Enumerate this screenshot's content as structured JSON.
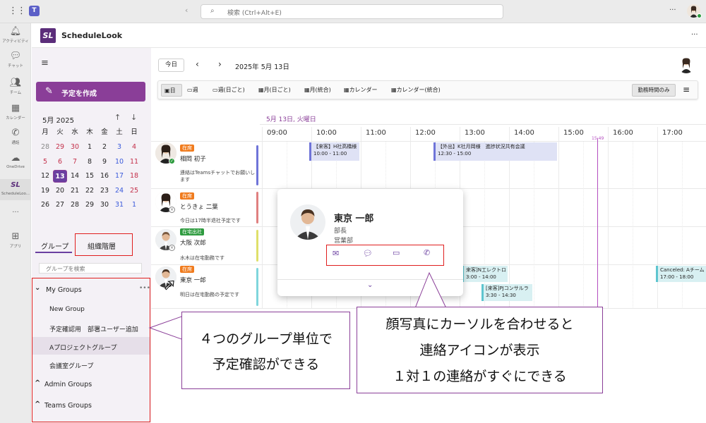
{
  "colors": {
    "brand": "#8a3e98",
    "accent_purple": "#6a3fa0",
    "red_outline": "#e01e1e",
    "event_blue": "#dfe2f5",
    "event_teal": "#d8f0f2",
    "current_time": "#b44ec0"
  },
  "titlebar": {
    "search_placeholder": "検索 (Ctrl+Alt+E)",
    "more": "···"
  },
  "rail": [
    {
      "label": "アクティビティ",
      "icon": "bell-icon"
    },
    {
      "label": "チャット",
      "icon": "chat-icon"
    },
    {
      "label": "チーム",
      "icon": "teams-icon"
    },
    {
      "label": "カレンダー",
      "icon": "calendar-icon"
    },
    {
      "label": "通話",
      "icon": "phone-icon"
    },
    {
      "label": "OneDrive",
      "icon": "cloud-icon"
    },
    {
      "label": "ScheduleLoo...",
      "icon": "schedulelook-icon"
    },
    {
      "label": "···",
      "icon": "more-icon"
    },
    {
      "label": "アプリ",
      "icon": "apps-icon"
    }
  ],
  "app": {
    "name": "ScheduleLook",
    "logo": "SL",
    "more": "···"
  },
  "left": {
    "create_label": "予定を作成",
    "month_label": "5月 2025",
    "weekdays": [
      "月",
      "火",
      "水",
      "木",
      "金",
      "土",
      "日"
    ],
    "weeks": [
      [
        "28",
        "29",
        "30",
        "1",
        "2",
        "3",
        "4"
      ],
      [
        "5",
        "6",
        "7",
        "8",
        "9",
        "10",
        "11"
      ],
      [
        "12",
        "13",
        "14",
        "15",
        "16",
        "17",
        "18"
      ],
      [
        "19",
        "20",
        "21",
        "22",
        "23",
        "24",
        "25"
      ],
      [
        "26",
        "27",
        "28",
        "29",
        "30",
        "31",
        "1"
      ]
    ],
    "tabs": {
      "group": "グループ",
      "org": "組織階層"
    },
    "search_placeholder": "グループを検索",
    "groups": {
      "my_groups": "My Groups",
      "items": [
        "New Group",
        "予定確認用　部署ユーザー追加",
        "Aプロジェクトグループ",
        "会議室グループ"
      ],
      "admin": "Admin Groups",
      "teams": "Teams Groups"
    }
  },
  "toolbar": {
    "today": "今日",
    "date": "2025年 5月 13日",
    "views": [
      "日",
      "週",
      "週(日ごと)",
      "月(日ごと)",
      "月(統合)",
      "カレンダー",
      "カレンダー(統合)"
    ],
    "work_hours": "勤務時間のみ"
  },
  "grid": {
    "day_label": "5月 13日, 火曜日",
    "hours": [
      "09:00",
      "10:00",
      "11:00",
      "12:00",
      "13:00",
      "14:00",
      "15:00",
      "16:00",
      "17:00"
    ],
    "now_label": "15:49"
  },
  "people": [
    {
      "status": "在席",
      "name": "相岡 初子",
      "note": "連絡はTeamsチャットでお願いします"
    },
    {
      "status": "在席",
      "name": "とうきょ 二葉",
      "note": "今日は17時半退社予定です"
    },
    {
      "status": "在宅出社",
      "name": "大阪 次郎",
      "note": "水木は在宅勤務です"
    },
    {
      "status": "在席",
      "name": "東京 一郎",
      "note": "明日は在宅勤務の予定です"
    }
  ],
  "events": [
    {
      "title": "【来客】H社高橋様",
      "time": "10:00 - 11:00"
    },
    {
      "title": "【外出】K社月岡様　進捗状況共有会議",
      "time": "12:30 - 15:00"
    },
    {
      "title": "来客]N工レクトロ",
      "time": "3:00 - 14:00"
    },
    {
      "title": "[来客]PJコンサルラ",
      "time": "3:30 - 14:30"
    },
    {
      "title": "Canceled: Aチーム",
      "time": "17:00 - 18:00"
    }
  ],
  "popup": {
    "name": "東京 一郎",
    "title": "部長",
    "dept": "営業部",
    "contact_icons": [
      "mail-icon",
      "chat-icon",
      "video-icon",
      "phone-icon"
    ]
  },
  "callouts": {
    "left_line1": "４つのグループ単位で",
    "left_line2": "予定確認ができる",
    "right_line1": "顔写真にカーソルを合わせると",
    "right_line2": "連絡アイコンが表示",
    "right_line3": "１対１の連絡がすぐにできる"
  }
}
